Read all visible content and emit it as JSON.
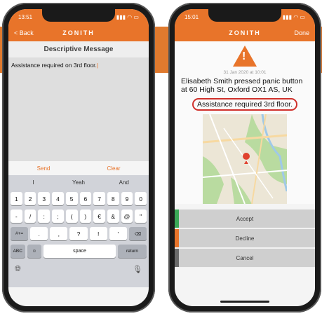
{
  "colors": {
    "brand": "#e8742a",
    "accept": "#3aa857",
    "decline": "#e8742a",
    "cancel": "#6b6b6b",
    "highlight": "#d0302b"
  },
  "left": {
    "status": {
      "time": "13:51",
      "icons": "▮▮▮ ◠ ▭"
    },
    "nav": {
      "back": "< Back",
      "brand": "ZONITH"
    },
    "title": "Descriptive Message",
    "message": "Assistance required on 3rd floor.",
    "buttons": {
      "send": "Send",
      "clear": "Clear"
    },
    "suggestions": [
      "I",
      "Yeah",
      "And"
    ],
    "keys": {
      "row1": [
        "1",
        "2",
        "3",
        "4",
        "5",
        "6",
        "7",
        "8",
        "9",
        "0"
      ],
      "row2": [
        "-",
        "/",
        ":",
        ";",
        "(",
        ")",
        "€",
        "&",
        "@",
        "\""
      ],
      "row3": [
        "#+=",
        ".",
        ",",
        "?",
        "!",
        "'",
        "⌫"
      ],
      "row4": [
        "ABC",
        "☺",
        "space",
        "return"
      ]
    },
    "globe_icon": "globe-icon",
    "mic_icon": "microphone-icon"
  },
  "right": {
    "status": {
      "time": "15:01",
      "icons": "▮▮▮ ◠ ▭"
    },
    "nav": {
      "brand": "ZONITH",
      "done": "Done"
    },
    "timestamp": "31 Jan 2020 at 10:01",
    "alert_text": "Elisabeth Smith pressed panic button  at 60 High St, Oxford OX1 AS, UK",
    "highlight_message": "Assistance required 3rd floor.",
    "actions": [
      "Accept",
      "Decline",
      "Cancel"
    ]
  }
}
